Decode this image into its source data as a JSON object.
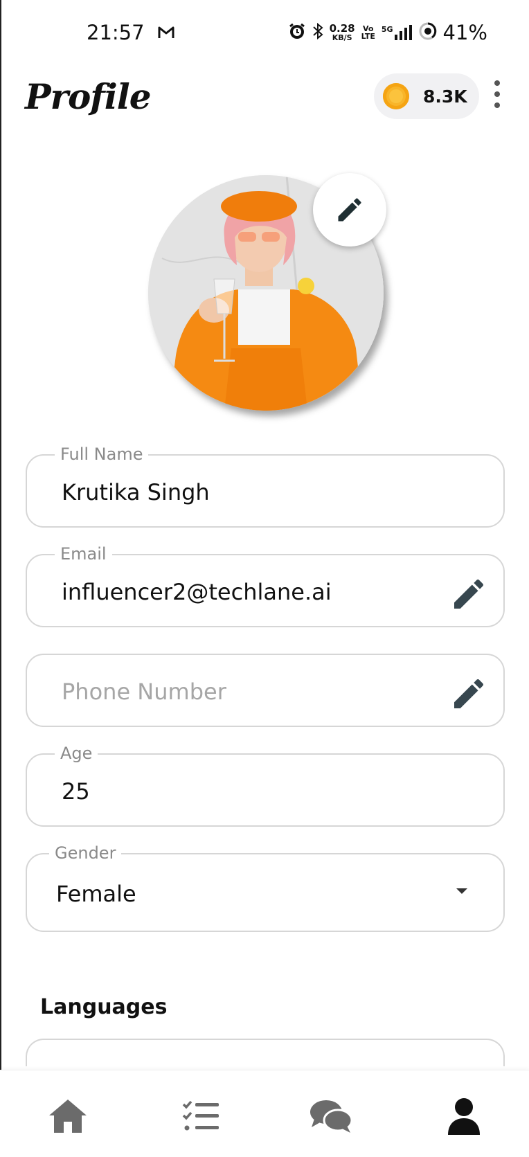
{
  "status_bar": {
    "time": "21:57",
    "net_speed_value": "0.28",
    "net_speed_unit": "KB/S",
    "volte_top": "Vo",
    "volte_bottom": "LTE",
    "network": "5G",
    "battery": "41%",
    "icons": [
      "gmail-icon",
      "alarm-icon",
      "bluetooth-icon",
      "signal-icon",
      "battery-icon"
    ]
  },
  "header": {
    "title": "Profile",
    "coins": "8.3K",
    "icons": [
      "coin-icon",
      "more-vertical-icon"
    ]
  },
  "avatar": {
    "icons": [
      "pencil-icon"
    ]
  },
  "form": {
    "full_name": {
      "label": "Full Name",
      "value": "Krutika Singh"
    },
    "email": {
      "label": "Email",
      "value": "influencer2@techlane.ai"
    },
    "phone": {
      "placeholder": "Phone Number"
    },
    "age": {
      "label": "Age",
      "value": "25"
    },
    "gender": {
      "label": "Gender",
      "value": "Female"
    }
  },
  "languages": {
    "heading": "Languages"
  },
  "bottom_nav": {
    "items": [
      "home-icon",
      "tasks-icon",
      "chat-icon",
      "profile-icon"
    ],
    "active": "profile-icon"
  },
  "colors": {
    "accent_coin": "#f8b52a",
    "border": "#d6d6d6",
    "icon_dark": "#37474f",
    "nav_inactive": "#6b6b6b",
    "nav_active": "#111111"
  }
}
